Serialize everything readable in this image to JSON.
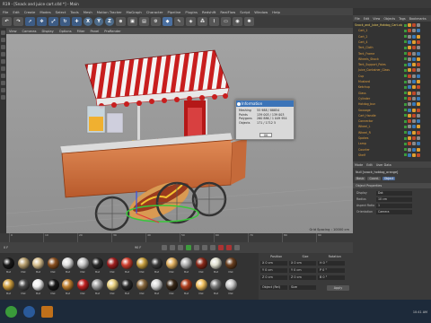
{
  "window": {
    "title": "R19 - [Snack and juice cart.c4d *] - Main"
  },
  "menubar": [
    "File",
    "Edit",
    "Create",
    "Modes",
    "Select",
    "Tools",
    "Mesh",
    "Motion Tracker",
    "MoGraph",
    "Character",
    "Pipeline",
    "Plugins",
    "Redshift",
    "RealFlow",
    "Script",
    "Window",
    "Help"
  ],
  "toolbar": {
    "axes": [
      "X",
      "Y",
      "Z"
    ]
  },
  "viewport_menu": [
    "View",
    "Cameras",
    "Display",
    "Options",
    "Filter",
    "Panel",
    "ProRender"
  ],
  "viewport_status": "Grid Spacing : 10000 cm",
  "timeline_ticks": [
    "0",
    "10",
    "20",
    "30",
    "40",
    "50",
    "60",
    "70",
    "80",
    "90"
  ],
  "frame_readouts": [
    "0 F",
    "90 F"
  ],
  "info_dialog": {
    "title": "Information",
    "rows": [
      {
        "k": "Meshing",
        "v": "55 988 / 88854"
      },
      {
        "k": "Points",
        "v": "139 003 / 139 003"
      },
      {
        "k": "Polygons",
        "v": "260 886 / 1 049 954"
      },
      {
        "k": "Objects",
        "v": "171 / 1712 5"
      }
    ],
    "ok_label": "OK"
  },
  "object_manager": {
    "menu": [
      "File",
      "Edit",
      "View",
      "Objects",
      "Tags",
      "Bookmarks"
    ],
    "rows": [
      {
        "name": "Snack_and_Juice_Hotdog_Cart.obj",
        "sel": true
      },
      {
        "name": "Cart_1",
        "sel": false
      },
      {
        "name": "Cart_2",
        "sel": false
      },
      {
        "name": "Cart_4",
        "sel": false
      },
      {
        "name": "Tent_Cloth",
        "sel": false
      },
      {
        "name": "Tent_Frame",
        "sel": false
      },
      {
        "name": "Wheels_Shock",
        "sel": false
      },
      {
        "name": "Tent_Support_Poles",
        "sel": false
      },
      {
        "name": "Juice_Container_Glass",
        "sel": false
      },
      {
        "name": "Cup",
        "sel": false
      },
      {
        "name": "Mustard",
        "sel": false
      },
      {
        "name": "Ketchup",
        "sel": false
      },
      {
        "name": "Glass",
        "sel": false
      },
      {
        "name": "Cylinder",
        "sel": false
      },
      {
        "name": "Hotdog_bun",
        "sel": false
      },
      {
        "name": "Sausage",
        "sel": false
      },
      {
        "name": "Cart_Handle",
        "sel": false
      },
      {
        "name": "Connector",
        "sel": false
      },
      {
        "name": "Wheel_L",
        "sel": false
      },
      {
        "name": "Wheel_R",
        "sel": false
      },
      {
        "name": "Spokes",
        "sel": false
      },
      {
        "name": "Lamp",
        "sel": false
      },
      {
        "name": "Counter",
        "sel": false
      },
      {
        "name": "Shelf",
        "sel": false
      }
    ]
  },
  "attribute_manager": {
    "menu": [
      "Mode",
      "Edit",
      "User Data"
    ],
    "title": "Null [snack_hotdog_orange]",
    "tabs": [
      {
        "label": "Basic",
        "active": false
      },
      {
        "label": "Coord.",
        "active": false
      },
      {
        "label": "Object",
        "active": true
      }
    ],
    "section": "Object Properties",
    "rows": [
      {
        "label": "Display",
        "value": "Dot"
      },
      {
        "label": "Radius",
        "value": "10 cm"
      },
      {
        "label": "Aspect Ratio",
        "value": "1"
      },
      {
        "label": "Orientation",
        "value": "Camera"
      }
    ]
  },
  "coordinates": {
    "headers": [
      "Position",
      "Size",
      "Rotation"
    ],
    "rows": [
      [
        "X  0 cm",
        "X  0 cm",
        "H  0 °"
      ],
      [
        "Y  0 cm",
        "Y  0 cm",
        "P  0 °"
      ],
      [
        "Z  0 cm",
        "Z  0 cm",
        "B  0 °"
      ]
    ],
    "mode_object": "Object (Rel)",
    "mode_size": "Size",
    "apply_label": "Apply"
  },
  "materials": [
    "Mat",
    "Mat",
    "Mat",
    "Mat",
    "Mat",
    "Mat",
    "Mat",
    "Mat",
    "Mat",
    "Mat",
    "Mat",
    "Mat",
    "Mat",
    "Mat",
    "Mat",
    "Mat",
    "Mat",
    "Mat",
    "Mat",
    "Mat",
    "Mat",
    "Mat",
    "Mat",
    "Mat",
    "Mat",
    "Mat",
    "Mat",
    "Mat",
    "Mat",
    "Mat",
    "Mat",
    "Mat"
  ],
  "taskbar": {
    "clock": "10:41 AM"
  },
  "colors": {
    "accent": "#4d6b9a",
    "object_name": "#e0a040",
    "info_header": "#3c74b8"
  }
}
